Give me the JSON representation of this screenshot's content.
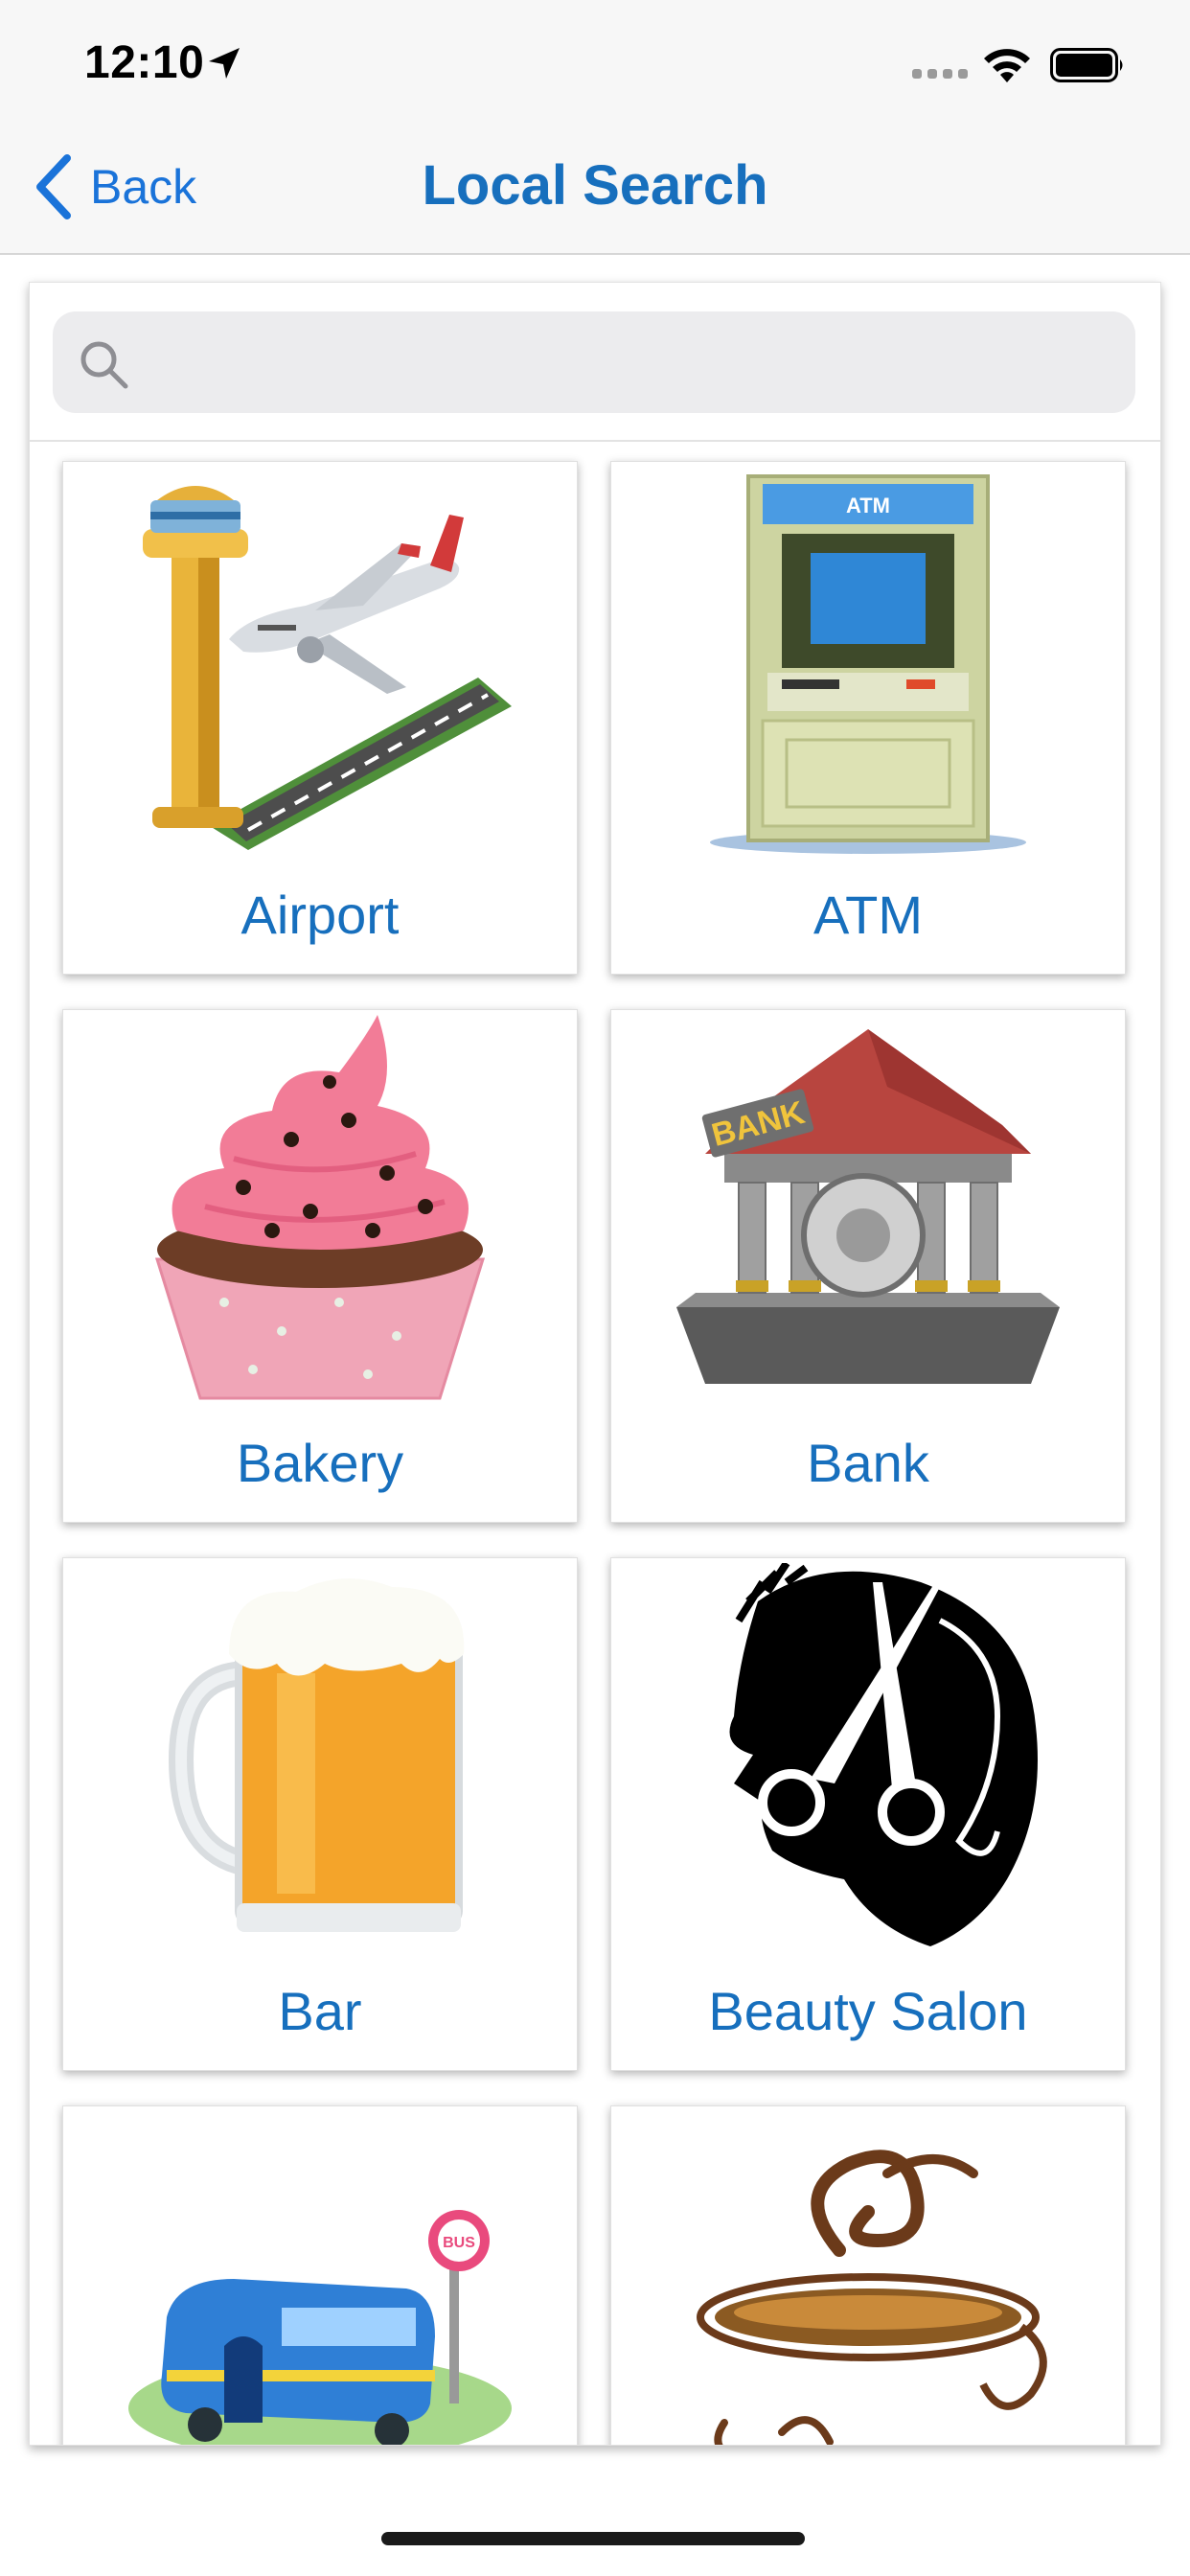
{
  "status_bar": {
    "time": "12:10"
  },
  "nav": {
    "back_label": "Back",
    "title": "Local Search"
  },
  "search": {
    "placeholder": "",
    "value": ""
  },
  "categories": [
    {
      "label": "Airport",
      "icon": "airport-icon"
    },
    {
      "label": "ATM",
      "icon": "atm-icon"
    },
    {
      "label": "Bakery",
      "icon": "cupcake-icon"
    },
    {
      "label": "Bank",
      "icon": "bank-icon"
    },
    {
      "label": "Bar",
      "icon": "beer-mug-icon"
    },
    {
      "label": "Beauty Salon",
      "icon": "scissors-head-icon"
    },
    {
      "label": "",
      "icon": "bus-stop-icon"
    },
    {
      "label": "",
      "icon": "coffee-cup-icon"
    }
  ],
  "colors": {
    "accent": "#176fbd",
    "back": "#1a73d9"
  }
}
